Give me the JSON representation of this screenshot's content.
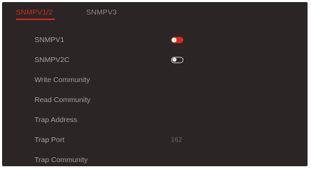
{
  "tabs": [
    {
      "label": "SNMPV1/2",
      "active": true
    },
    {
      "label": "SNMPV3",
      "active": false
    }
  ],
  "settings": {
    "snmpv1": {
      "label": "SNMPV1",
      "enabled": true
    },
    "snmpv2c": {
      "label": "SNMPV2C",
      "enabled": false
    },
    "write_community": {
      "label": "Write Community",
      "value": ""
    },
    "read_community": {
      "label": "Read Community",
      "value": ""
    },
    "trap_address": {
      "label": "Trap Address",
      "value": ""
    },
    "trap_port": {
      "label": "Trap Port",
      "value": "162"
    },
    "trap_community": {
      "label": "Trap Community",
      "value": ""
    }
  },
  "colors": {
    "accent": "#d42a1e",
    "panel_bg": "#2b2625",
    "label_text": "#a49f9e",
    "inactive_tab": "#8c8685"
  },
  "icons": {
    "toggle_on": "toggle-on-icon",
    "toggle_off": "toggle-off-icon"
  }
}
